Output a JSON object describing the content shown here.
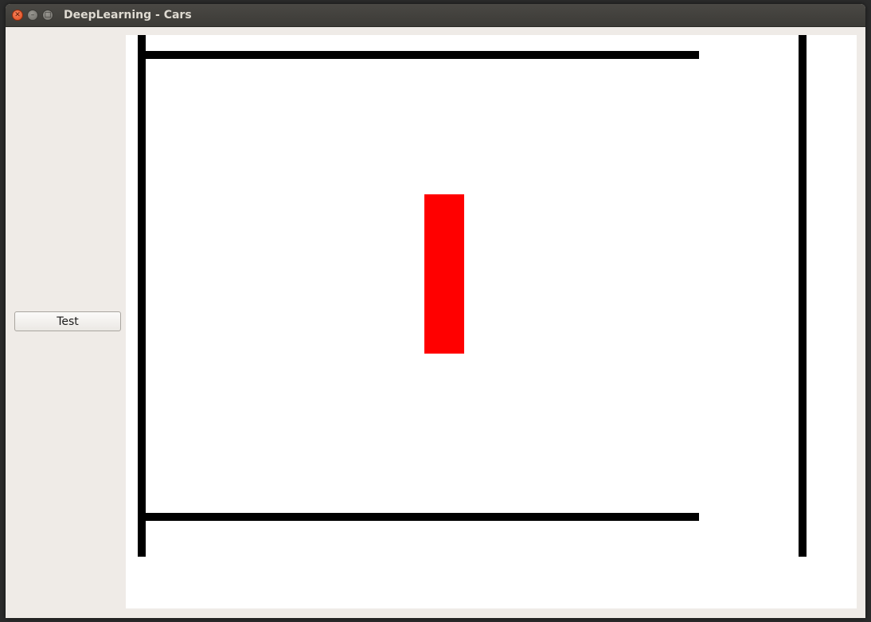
{
  "window": {
    "title": "DeepLearning - Cars",
    "controls": {
      "close_icon": "close-icon",
      "minimize_icon": "minimize-icon",
      "maximize_icon": "maximize-icon"
    }
  },
  "sidebar": {
    "test_button_label": "Test"
  },
  "scene": {
    "background_color": "#ffffff",
    "wall_color": "#000000",
    "car_color": "#ff0000"
  }
}
